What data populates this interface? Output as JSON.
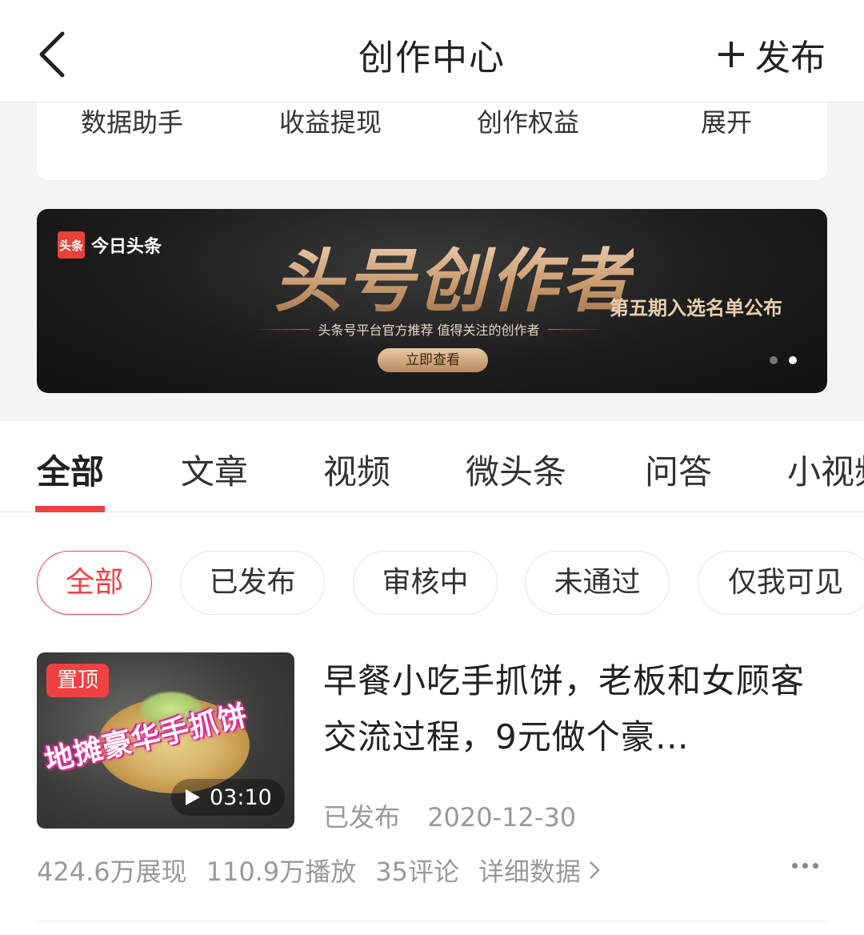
{
  "header": {
    "title": "创作中心",
    "publish_label": "发布"
  },
  "shortcuts": [
    {
      "label": "数据助手"
    },
    {
      "label": "收益提现"
    },
    {
      "label": "创作权益"
    },
    {
      "label": "展开"
    }
  ],
  "banner": {
    "brand": "今日头条",
    "brand_logo_text": "头条",
    "headline": "头号创作者",
    "subtitle": "头条号平台官方推荐 值得关注的创作者",
    "cta": "立即查看",
    "announcement": "第五期入选名单公布",
    "page_count": 2,
    "active_page": 2
  },
  "tabs": [
    {
      "label": "全部",
      "active": true
    },
    {
      "label": "文章"
    },
    {
      "label": "视频"
    },
    {
      "label": "微头条"
    },
    {
      "label": "问答"
    },
    {
      "label": "小视频"
    }
  ],
  "filters": [
    {
      "label": "全部",
      "active": true
    },
    {
      "label": "已发布"
    },
    {
      "label": "审核中"
    },
    {
      "label": "未通过"
    },
    {
      "label": "仅我可见"
    }
  ],
  "article": {
    "pin_badge": "置顶",
    "thumb_caption": "地摊豪华手抓饼",
    "duration": "03:10",
    "title": "早餐小吃手抓饼，老板和女顾客交流过程，9元做个豪…",
    "status": "已发布",
    "date": "2020-12-30",
    "impressions": "424.6万展现",
    "plays": "110.9万播放",
    "comments": "35评论",
    "detail_link": "详细数据"
  },
  "colors": {
    "accent": "#f04142",
    "banner_gold": "#c99a6e",
    "muted_text": "#999999"
  },
  "icons": [
    "back-arrow-icon",
    "plus-icon",
    "play-icon",
    "chevron-right-icon",
    "more-dots-icon"
  ]
}
